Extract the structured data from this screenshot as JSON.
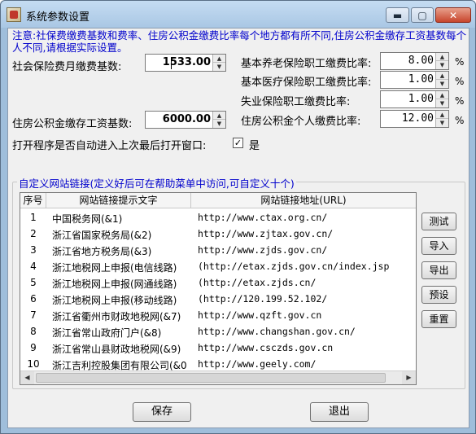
{
  "window": {
    "title": "系统参数设置",
    "controls": {
      "minimize": "▬",
      "maximize": "▢",
      "close": "✕"
    }
  },
  "notice": "注意:社保费缴费基数和费率、住房公积金缴费比率每个地方都有所不同,住房公积金缴存工资基数每个人不同,请根据实际设置。",
  "social_base": {
    "label": "社会保险费月缴费基数:",
    "value": "1533.00"
  },
  "housing_base": {
    "label": "住房公积金缴存工资基数:",
    "value": "6000.00"
  },
  "rates": [
    {
      "label": "基本养老保险职工缴费比率:",
      "value": "8.00",
      "unit": "%"
    },
    {
      "label": "基本医疗保险职工缴费比率:",
      "value": "1.00",
      "unit": "%"
    },
    {
      "label": "失业保险职工缴费比率:",
      "value": "1.00",
      "unit": "%"
    },
    {
      "label": "住房公积金个人缴费比率:",
      "value": "12.00",
      "unit": "%"
    }
  ],
  "auto_open": {
    "label": "打开程序是否自动进入上次最后打开窗口:",
    "checked": true,
    "check_mark": "✓",
    "option_label": "是"
  },
  "links_group": {
    "title": "自定义网站链接(定义好后可在帮助菜单中访问,可自定义十个)",
    "columns": [
      "序号",
      "网站链接提示文字",
      "网站链接地址(URL)"
    ],
    "rows": [
      {
        "num": "1",
        "name": "中国税务网(&1)",
        "url": "http://www.ctax.org.cn/"
      },
      {
        "num": "2",
        "name": "浙江省国家税务局(&2)",
        "url": "http://www.zjtax.gov.cn/"
      },
      {
        "num": "3",
        "name": "浙江省地方税务局(&3)",
        "url": "http://www.zjds.gov.cn/"
      },
      {
        "num": "4",
        "name": "浙江地税网上申报(电信线路)",
        "url": "(http://etax.zjds.gov.cn/index.jsp"
      },
      {
        "num": "5",
        "name": "浙江地税网上申报(网通线路)",
        "url": "(http://etax.zjds.cn/"
      },
      {
        "num": "6",
        "name": "浙江地税网上申报(移动线路)",
        "url": "(http://120.199.52.102/"
      },
      {
        "num": "7",
        "name": "浙江省衢州市财政地税网(&7)",
        "url": "http://www.qzft.gov.cn"
      },
      {
        "num": "8",
        "name": "浙江省常山政府门户(&8)",
        "url": "http://www.changshan.gov.cn/"
      },
      {
        "num": "9",
        "name": "浙江省常山县财政地税网(&9)",
        "url": "http://www.csczds.gov.cn"
      },
      {
        "num": "10",
        "name": "浙江吉利控股集团有限公司(&0",
        "url": "http://www.geely.com/"
      }
    ]
  },
  "side_buttons": [
    "测试",
    "导入",
    "导出",
    "预设",
    "重置"
  ],
  "footer": {
    "save": "保存",
    "exit": "退出"
  }
}
